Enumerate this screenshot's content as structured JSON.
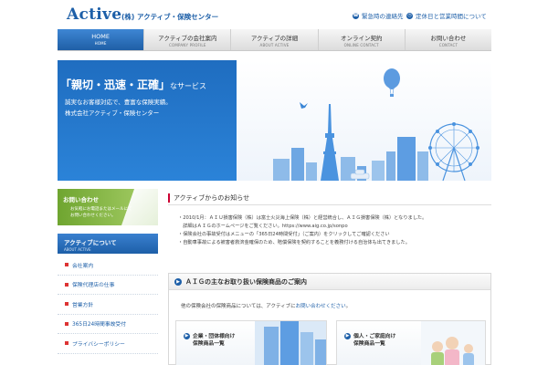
{
  "header": {
    "logo": "Active",
    "logo_sub": "(株) アクティブ・保険センター",
    "links": [
      {
        "label": "緊急時の連絡先",
        "icon": "phone-icon"
      },
      {
        "label": "定休日と営業時間について",
        "icon": "clock-icon"
      }
    ]
  },
  "nav": {
    "items": [
      {
        "jp": "HOME",
        "en": "HOME",
        "active": true
      },
      {
        "jp": "アクティブの会社案内",
        "en": "COMPANY PROFILE",
        "active": false
      },
      {
        "jp": "アクティブの詳細",
        "en": "ABOUT ACTIVE",
        "active": false
      },
      {
        "jp": "オンライン契約",
        "en": "ONLINE CONTACT",
        "active": false
      },
      {
        "jp": "お問い合わせ",
        "en": "CONTACT",
        "active": false
      }
    ]
  },
  "hero": {
    "title": "「親切・迅速・正確」",
    "title_suffix": "なサービス",
    "text1": "誠実なお客様対応で、豊富な保険実績。",
    "text2": "株式会社アクティブ・保険センター"
  },
  "sidebar": {
    "contact_title": "お問い合わせ",
    "contact_desc1": "お気軽にお電話またはメールにて",
    "contact_desc2": "お問い合わせください。",
    "about_title": "アクティブについて",
    "about_en": "ABOUT ACTIVE",
    "items": [
      {
        "label": "会社案内"
      },
      {
        "label": "保険代理店の仕事"
      },
      {
        "label": "営業方針"
      },
      {
        "label": "365日24時間事故受付"
      },
      {
        "label": "プライバシーポリシー"
      }
    ]
  },
  "notice": {
    "heading": "アクティブからのお知らせ",
    "lines": [
      "・2010/1月：ＡＩＵ損害保険（株）は富士火災海上保険（株）と経営統合し、ＡＩＧ損害保険（株）となりました。",
      "　詳細はＡＩＧのホームページをご覧ください。https://www.aig.co.jp/sonpo",
      "・保険会社の事故受付はメニューの「365日24時間受付」（ご案内）をクリックしてご確認ください",
      "・自動車事故による被害者救済金確保のため、賠償保険を契約することを義務付ける自治体も出てきました。"
    ]
  },
  "aig": {
    "heading": "ＡＩＧの主なお取り扱い保険商品のご案内",
    "desc_prefix": "他の保険会社の保険商品については、アクティブに",
    "desc_link": "お問い合わせください",
    "desc_suffix": "。",
    "cards": [
      {
        "line1": "企業・団体様向け",
        "line2": "保険商品一覧"
      },
      {
        "line1": "個人・ご家庭向け",
        "line2": "保険商品一覧"
      }
    ]
  },
  "colors": {
    "brand_blue": "#1d5fa8",
    "hero_blue": "#2378cc",
    "accent_green": "#8cbf4a",
    "accent_red": "#cc0033"
  }
}
